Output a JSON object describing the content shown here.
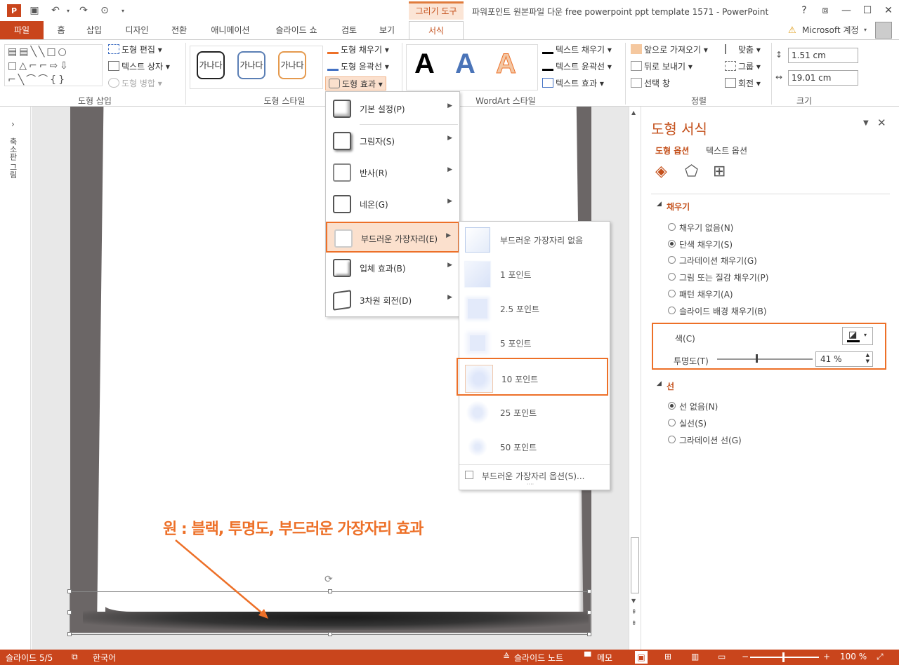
{
  "titlebar": {
    "context_tab": "그리기 도구",
    "window_title": "파워포인트 원본파일 다운 free powerpoint ppt template 1571 - PowerPoint",
    "controls": {
      "help": "?",
      "restore": "⧈",
      "minimize": "—",
      "maximize": "☐",
      "close": "✕"
    }
  },
  "tabs": {
    "file": "파일",
    "items": [
      "홈",
      "삽입",
      "디자인",
      "전환",
      "애니메이션",
      "슬라이드 쇼",
      "검토",
      "보기"
    ],
    "format": "서식",
    "account": "Microsoft 계정"
  },
  "ribbon": {
    "groups": {
      "insert_shapes": "도형 삽입",
      "shape_styles": "도형 스타일",
      "wordart_styles": "WordArt 스타일",
      "arrange": "정렬",
      "size": "크기"
    },
    "edit_shape": "도형 편집",
    "text_box": "텍스트 상자",
    "merge_shapes": "도형 병합",
    "style_sample": "가나다",
    "shape_fill": "도형 채우기",
    "shape_outline": "도형 윤곽선",
    "shape_effects": "도형 효과",
    "wordart_letter": "A",
    "text_fill": "텍스트 채우기",
    "text_outline": "텍스트 윤곽선",
    "text_effects": "텍스트 효과",
    "bring_forward": "앞으로 가져오기",
    "send_backward": "뒤로 보내기",
    "selection_pane": "선택 창",
    "align": "맞춤",
    "group": "그룹",
    "rotate": "회전",
    "height": "1.51 cm",
    "width": "19.01 cm"
  },
  "thumbnail_panel": {
    "label": "축소판 그림"
  },
  "annotation": "원 : 블랙, 투명도, 부드러운 가장자리 효과",
  "effects_menu": {
    "items": [
      {
        "label": "기본 설정(P)"
      },
      {
        "label": "그림자(S)"
      },
      {
        "label": "반사(R)"
      },
      {
        "label": "네온(G)"
      },
      {
        "label": "부드러운 가장자리(E)"
      },
      {
        "label": "입체 효과(B)"
      },
      {
        "label": "3차원 회전(D)"
      }
    ]
  },
  "soft_edges_submenu": {
    "items": [
      "부드러운 가장자리 없음",
      "1 포인트",
      "2.5 포인트",
      "5 포인트",
      "10 포인트",
      "25 포인트",
      "50 포인트"
    ],
    "options": "부드러운 가장자리 옵션(S)..."
  },
  "format_pane": {
    "title": "도형 서식",
    "tab_shape": "도형 옵션",
    "tab_text": "텍스트 옵션",
    "fill_section": "채우기",
    "fill_options": [
      {
        "label": "채우기 없음(N)",
        "selected": false
      },
      {
        "label": "단색 채우기(S)",
        "selected": true
      },
      {
        "label": "그라데이션 채우기(G)",
        "selected": false
      },
      {
        "label": "그림 또는 질감 채우기(P)",
        "selected": false
      },
      {
        "label": "패턴 채우기(A)",
        "selected": false
      },
      {
        "label": "슬라이드 배경 채우기(B)",
        "selected": false
      }
    ],
    "color_label": "색(C)",
    "transparency_label": "투명도(T)",
    "transparency_value": "41 %",
    "transparency": 0.41,
    "line_section": "선",
    "line_options": [
      {
        "label": "선 없음(N)",
        "selected": true
      },
      {
        "label": "실선(S)",
        "selected": false
      },
      {
        "label": "그라데이션 선(G)",
        "selected": false
      }
    ]
  },
  "statusbar": {
    "slide": "슬라이드 5/5",
    "language": "한국어",
    "notes": "슬라이드 노트",
    "comments": "메모",
    "zoom": "100 %"
  },
  "colors": {
    "accent": "#c9451c",
    "highlight": "#ed7028"
  }
}
